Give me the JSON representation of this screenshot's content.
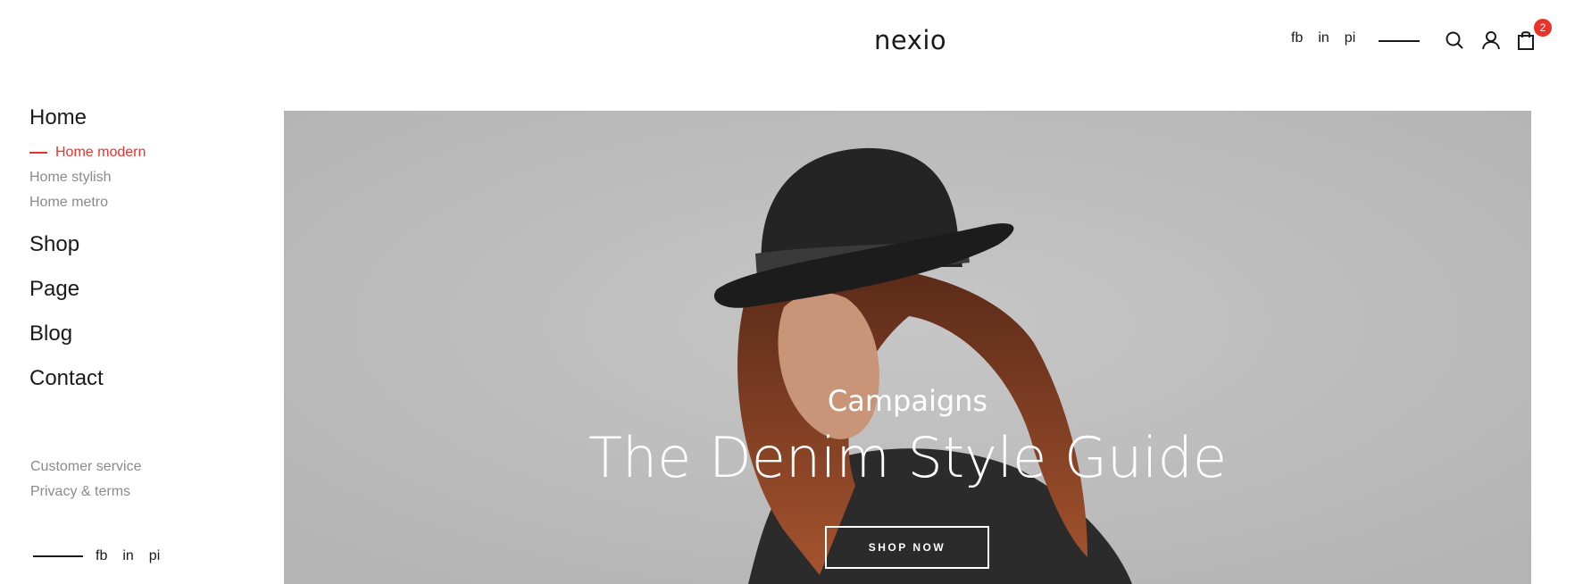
{
  "header": {
    "logo": "nexio",
    "social": [
      "fb",
      "in",
      "pi"
    ],
    "cart_count": "2",
    "icons": [
      "search-icon",
      "user-icon",
      "cart-icon"
    ]
  },
  "sidebar": {
    "home": "Home",
    "sub_items": [
      {
        "label": "Home modern",
        "active": true
      },
      {
        "label": "Home stylish",
        "active": false
      },
      {
        "label": "Home metro",
        "active": false
      }
    ],
    "shop": "Shop",
    "page": "Page",
    "blog": "Blog",
    "contact": "Contact",
    "footer_links": [
      "Customer service",
      "Privacy & terms"
    ],
    "social": [
      "fb",
      "in",
      "pi"
    ]
  },
  "hero": {
    "subtitle": "Campaigns",
    "title": "The Denim Style Guide",
    "button": "SHOP NOW"
  },
  "colors": {
    "accent": "#e8332c",
    "text": "#1a1a1a",
    "muted": "#8a8a8a",
    "hero_bg": "#bfbfbf"
  }
}
